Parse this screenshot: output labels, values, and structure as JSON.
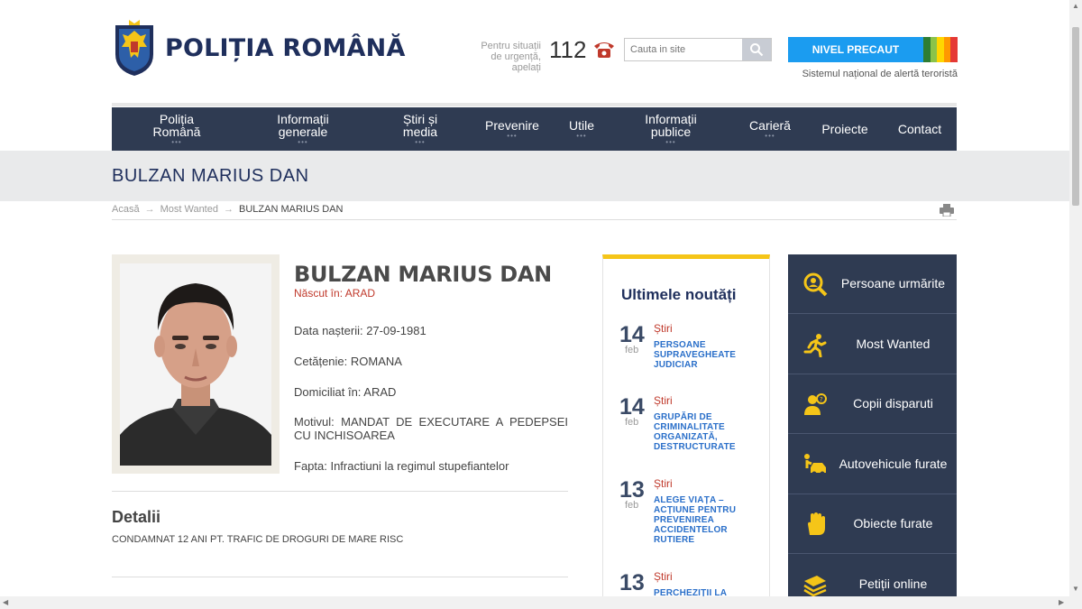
{
  "header": {
    "logo_text": "POLIȚIA ROMÂNĂ",
    "emergency_label": "Pentru situații de urgență, apelați",
    "emergency_number": "112",
    "search_placeholder": "Cauta in site",
    "alert_label": "NIVEL PRECAUT",
    "alert_caption": "Sistemul național de alertă teroristă",
    "alert_colors": [
      "#2e7d32",
      "#8bc34a",
      "#ffd600",
      "#ff9800",
      "#e53935"
    ]
  },
  "nav": {
    "items": [
      {
        "label": "Poliția Română",
        "has_submenu": true
      },
      {
        "label": "Informații generale",
        "has_submenu": true
      },
      {
        "label": "Știri și media",
        "has_submenu": true
      },
      {
        "label": "Prevenire",
        "has_submenu": true
      },
      {
        "label": "Utile",
        "has_submenu": true
      },
      {
        "label": "Informații publice",
        "has_submenu": true
      },
      {
        "label": "Carieră",
        "has_submenu": true
      },
      {
        "label": "Proiecte",
        "has_submenu": false
      },
      {
        "label": "Contact",
        "has_submenu": false
      }
    ]
  },
  "page": {
    "title": "BULZAN MARIUS DAN"
  },
  "breadcrumb": {
    "items": [
      "Acasă",
      "Most Wanted",
      "BULZAN MARIUS DAN"
    ]
  },
  "profile": {
    "name": "BULZAN MARIUS DAN",
    "born_in": "Născut în: ARAD",
    "birth_date": "Data nașterii: 27-09-1981",
    "citizenship": "Cetățenie: ROMANA",
    "residence": "Domiciliat în: ARAD",
    "reason": "Motivul: MANDAT DE EXECUTARE A PEDEPSEI CU INCHISOAREA",
    "offence": "Fapta: Infractiuni la regimul stupefiantelor",
    "details_title": "Detalii",
    "details_text": "CONDAMNAT 12 ANI PT. TRAFIC DE DROGURI DE MARE RISC"
  },
  "news": {
    "title": "Ultimele noutăți",
    "items": [
      {
        "day": "14",
        "month": "feb",
        "category": "Știri",
        "headline": "PERSOANE SUPRAVEGHEATE JUDICIAR"
      },
      {
        "day": "14",
        "month": "feb",
        "category": "Știri",
        "headline": "GRUPĂRI DE CRIMINALITATE ORGANIZATĂ, DESTRUCTURATE"
      },
      {
        "day": "13",
        "month": "feb",
        "category": "Știri",
        "headline": "ALEGE VIAȚA – ACȚIUNE PENTRU PREVENIREA ACCIDENTELOR RUTIERE"
      },
      {
        "day": "13",
        "month": "feb",
        "category": "Știri",
        "headline": "PERCHEZIȚII LA"
      }
    ]
  },
  "side_menu": {
    "items": [
      {
        "label": "Persoane urmărite",
        "icon": "search-person-icon"
      },
      {
        "label": "Most Wanted",
        "icon": "running-person-icon"
      },
      {
        "label": "Copii disparuti",
        "icon": "missing-child-icon"
      },
      {
        "label": "Autovehicule furate",
        "icon": "stolen-car-icon"
      },
      {
        "label": "Obiecte furate",
        "icon": "hand-icon"
      },
      {
        "label": "Petiții online",
        "icon": "documents-icon"
      }
    ]
  },
  "colors": {
    "nav_bg": "#2f3b52",
    "brand_blue": "#1f2f5c",
    "accent_red": "#c0392b",
    "news_accent": "#f5c518",
    "link_blue": "#2a6fc9",
    "icon_yellow": "#f5c518"
  }
}
